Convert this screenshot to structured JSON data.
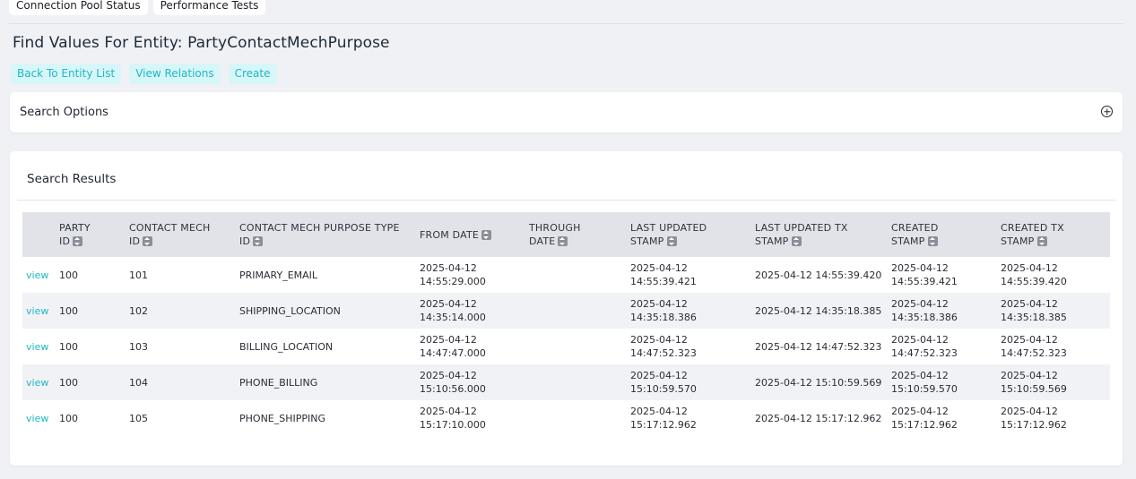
{
  "top_tabs": [
    "Connection Pool Status",
    "Performance Tests"
  ],
  "page_title": "Find Values For Entity: PartyContactMechPurpose",
  "actions": [
    "Back To Entity List",
    "View Relations",
    "Create"
  ],
  "search_options": {
    "label": "Search Options"
  },
  "results": {
    "title": "Search Results",
    "columns": [
      {
        "line1": "PARTY",
        "line2": "ID"
      },
      {
        "line1": "CONTACT MECH",
        "line2": "ID"
      },
      {
        "line1": "CONTACT MECH PURPOSE TYPE",
        "line2": "ID"
      },
      {
        "line1": "",
        "line2": "FROM DATE"
      },
      {
        "line1": "THROUGH",
        "line2": "DATE"
      },
      {
        "line1": "LAST UPDATED",
        "line2": "STAMP"
      },
      {
        "line1": "LAST UPDATED TX",
        "line2": "STAMP"
      },
      {
        "line1": "CREATED",
        "line2": "STAMP"
      },
      {
        "line1": "CREATED TX",
        "line2": "STAMP"
      }
    ],
    "view_label": "view",
    "rows": [
      {
        "party": "100",
        "cm": "101",
        "purpose": "PRIMARY_EMAIL",
        "from1": "2025-04-12",
        "from2": "14:55:29.000",
        "through": "",
        "lus": "2025-04-12 14:55:39.421",
        "lutx": "2025-04-12 14:55:39.420",
        "cs1": "2025-04-12",
        "cs2": "14:55:39.421",
        "ctx1": "2025-04-12",
        "ctx2": "14:55:39.420"
      },
      {
        "party": "100",
        "cm": "102",
        "purpose": "SHIPPING_LOCATION",
        "from1": "2025-04-12",
        "from2": "14:35:14.000",
        "through": "",
        "lus": "2025-04-12 14:35:18.386",
        "lutx": "2025-04-12 14:35:18.385",
        "cs1": "2025-04-12",
        "cs2": "14:35:18.386",
        "ctx1": "2025-04-12",
        "ctx2": "14:35:18.385"
      },
      {
        "party": "100",
        "cm": "103",
        "purpose": "BILLING_LOCATION",
        "from1": "2025-04-12",
        "from2": "14:47:47.000",
        "through": "",
        "lus": "2025-04-12 14:47:52.323",
        "lutx": "2025-04-12 14:47:52.323",
        "cs1": "2025-04-12",
        "cs2": "14:47:52.323",
        "ctx1": "2025-04-12",
        "ctx2": "14:47:52.323"
      },
      {
        "party": "100",
        "cm": "104",
        "purpose": "PHONE_BILLING",
        "from1": "2025-04-12",
        "from2": "15:10:56.000",
        "through": "",
        "lus": "2025-04-12 15:10:59.570",
        "lutx": "2025-04-12 15:10:59.569",
        "cs1": "2025-04-12",
        "cs2": "15:10:59.570",
        "ctx1": "2025-04-12",
        "ctx2": "15:10:59.569"
      },
      {
        "party": "100",
        "cm": "105",
        "purpose": "PHONE_SHIPPING",
        "from1": "2025-04-12",
        "from2": "15:17:10.000",
        "through": "",
        "lus": "2025-04-12 15:17:12.962",
        "lutx": "2025-04-12 15:17:12.962",
        "cs1": "2025-04-12",
        "cs2": "15:17:12.962",
        "ctx1": "2025-04-12",
        "ctx2": "15:17:12.962"
      }
    ]
  },
  "icons": {
    "expand": "plus-circle-icon",
    "sort": "sort-icon"
  }
}
